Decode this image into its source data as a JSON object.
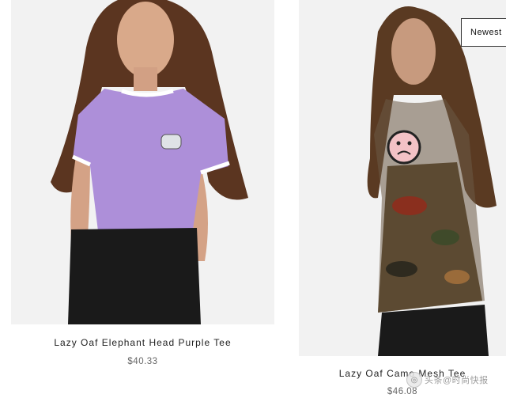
{
  "sort": {
    "label": "Newest"
  },
  "products": [
    {
      "name": "Lazy Oaf Elephant Head Purple Tee",
      "price": "$40.33"
    },
    {
      "name": "Lazy Oaf Camo Mesh Tee",
      "price": "$46.08"
    }
  ],
  "watermark": {
    "text": "头条@时尚快报"
  },
  "colors": {
    "purple_tee": "#ad8fd9",
    "background_panel": "#f2f2f2",
    "text": "#222222",
    "price": "#666666"
  }
}
